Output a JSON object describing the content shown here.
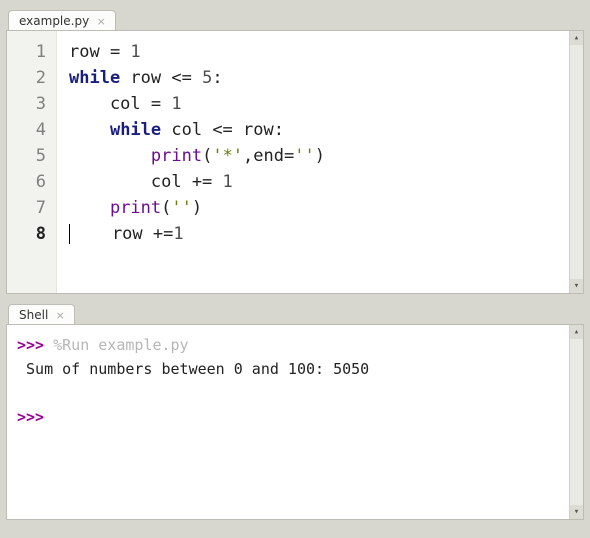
{
  "editor": {
    "tab_label": "example.py",
    "active_line": 8,
    "lines": [
      {
        "n": 1,
        "tokens": [
          [
            "op",
            "row = "
          ],
          [
            "num",
            "1"
          ]
        ]
      },
      {
        "n": 2,
        "tokens": [
          [
            "kw",
            "while"
          ],
          [
            "op",
            " row <= "
          ],
          [
            "num",
            "5"
          ],
          [
            "op",
            ":"
          ]
        ]
      },
      {
        "n": 3,
        "tokens": [
          [
            "op",
            "    col = "
          ],
          [
            "num",
            "1"
          ]
        ]
      },
      {
        "n": 4,
        "tokens": [
          [
            "op",
            "    "
          ],
          [
            "kw",
            "while"
          ],
          [
            "op",
            " col <= row:"
          ]
        ]
      },
      {
        "n": 5,
        "tokens": [
          [
            "op",
            "        "
          ],
          [
            "fn",
            "print"
          ],
          [
            "op",
            "("
          ],
          [
            "str",
            "'*'"
          ],
          [
            "op",
            ",end="
          ],
          [
            "str",
            "''"
          ],
          [
            "op",
            ")"
          ]
        ]
      },
      {
        "n": 6,
        "tokens": [
          [
            "op",
            "        col += "
          ],
          [
            "num",
            "1"
          ]
        ]
      },
      {
        "n": 7,
        "tokens": [
          [
            "op",
            "    "
          ],
          [
            "fn",
            "print"
          ],
          [
            "op",
            "("
          ],
          [
            "str",
            "''"
          ],
          [
            "op",
            ")"
          ]
        ]
      },
      {
        "n": 8,
        "cursor": true,
        "tokens": [
          [
            "op",
            "    row +="
          ],
          [
            "num",
            "1"
          ]
        ]
      }
    ]
  },
  "shell": {
    "tab_label": "Shell",
    "prompt": ">>>",
    "run_cmd": "%Run example.py",
    "output": " Sum of numbers between 0 and 100: 5050"
  }
}
